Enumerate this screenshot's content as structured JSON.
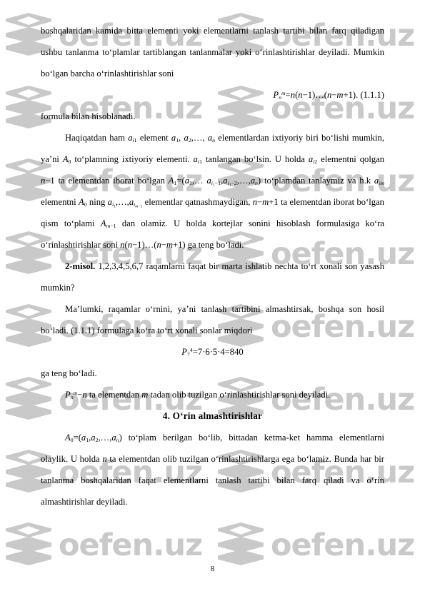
{
  "document": {
    "page_number": "8",
    "language": "uz",
    "watermark": {
      "text": "oefen.uz",
      "logo_icon": "stacked-diamond-logo-icon",
      "color": "#c9c9c9"
    }
  },
  "paragraphs": {
    "p1": "boshqalaridan kamida bitta elementi yoki elementlarni tanlash tartibi bilan farq qiladigan ushbu tanlanma to‘plamlar tartiblangan tanlanmalar yoki o‘rinlashtirishlar deyiladi. Mumkin bo‘lgan barcha o‘rinlashtirishlar soni",
    "p2_after_formula": "formula bilan hisoblanadi.",
    "p3_seg1": "Haqiqatdan ham",
    "p3_seg2": "element",
    "p3_seg3": "elementlardan ixtiyoriy biri bo‘lishi mumkin, ya’ni",
    "p3_seg4": "to‘plamning ixtiyoriy elementi.",
    "p3_seg5": "tanlangan bo‘lsin. U holda",
    "p3_seg6": "elementni qolgan",
    "p3_seg7": "ta elementdan iborat bo‘lgan",
    "p3_seg8": "to‘plamdan tanlaymiz va h.k",
    "p3_seg9": "elementni",
    "p3_seg10": "ning",
    "p3_seg11": "elementlar qatnashmaydigan,",
    "p3_seg12": "ta elementdan iborat bo‘lgan qism to‘plami",
    "p3_seg13": "dan olamiz. U holda kortejlar sonini hisoblash formulasiga ko‘ra o‘rinlashtirishlar soni",
    "p3_seg14": "ga teng bo‘ladi.",
    "example_label": "2-misol.",
    "example_digits": "1,2,3,4,5,6,7",
    "example_text": "raqamlarni faqat bir marta ishlatib nechta to‘rt xonali son yasash mumkin?",
    "p5": "Ma’lumki, raqamlar o‘rnini, ya’ni tanlash tartibini almashtirsak, boshqa son hosil bo‘ladi. (1.1.1) formulaga ko‘ra to‘rt xonali sonlar miqdori",
    "p6_after_formula": "ga teng bo‘ladi.",
    "p7_seg1": "ta elementdan",
    "p7_seg2": "tadan olib tuzilgan o‘rinlashtirishlar soni deyiladi.",
    "section_heading": "4.  O‘rin   almashtirishlar",
    "p8_seg1": "to‘plam berilgan bo‘lib, bittadan ketma-ket hamma elementlarni olaylik. U holda",
    "p8_seg2": "ta elementdan olib tuzilgan o‘rinlashtirishlarga ega bo‘lamiz. Bunda har bir tanlanma boshqalaridan faqat elementlarni tanlash tartibi bilan farq qiladi va o‘rin almashtirishlar deyiladi."
  },
  "formulas": {
    "f1_display": "P_n^m = n(n−1)…(n−m+1) .",
    "f1_number": "(1.1.1)",
    "f2_display": "P_7^4 = 7·6·5·4 = 840",
    "inline_a_i1": "a_i1",
    "inline_a_list": "a_1, a_2, …, a_n",
    "inline_A0": "A_0",
    "inline_a_i2": "a_i2",
    "inline_n_minus_1": "n−1",
    "inline_A1_set": "A_1 = (a_1, … a_i1−1, a_i1−2, …, a_n)",
    "inline_a_im": "a_im",
    "inline_a_i_seq": "a_i1, …, a_i(m−1)",
    "inline_n_m_1": "n−m+1",
    "inline_A_m_1": "A_m−1",
    "inline_product": "n(n−1)…(n−m+1)",
    "inline_Pnm_minus_n": "P_n^m − n",
    "inline_m": "m",
    "inline_A0_set": "A_0 = (a_1, a_2, …, a_n)",
    "inline_n": "n"
  }
}
